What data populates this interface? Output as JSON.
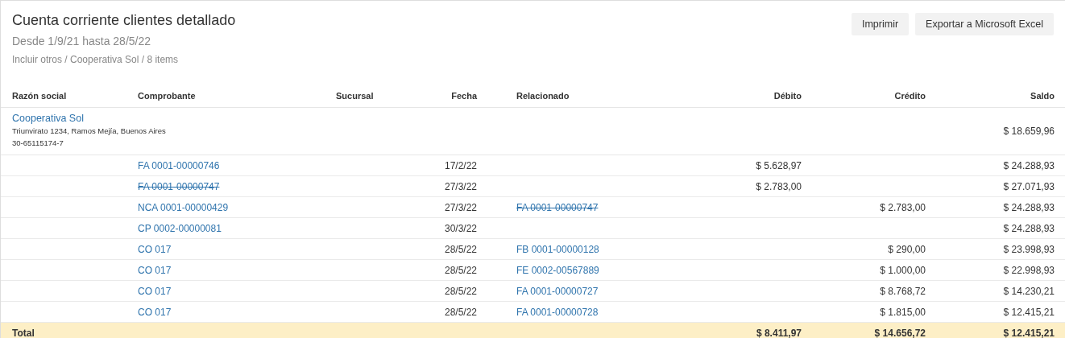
{
  "report": {
    "title": "Cuenta corriente clientes detallado",
    "period": "Desde 1/9/21 hasta 28/5/22",
    "filters": "Incluir otros / Cooperativa Sol / 8 items"
  },
  "buttons": [
    {
      "label": "Imprimir"
    },
    {
      "label": "Exportar a Microsoft Excel"
    }
  ],
  "table": {
    "columns": [
      {
        "label": "Razón social"
      },
      {
        "label": "Comprobante"
      },
      {
        "label": "Sucursal"
      },
      {
        "label": "Fecha"
      },
      {
        "label": "Relacionado"
      },
      {
        "label": "Débito"
      },
      {
        "label": "Crédito"
      },
      {
        "label": "Saldo"
      }
    ],
    "client": {
      "name": "Cooperativa Sol",
      "address": "Triunvirato 1234, Ramos Mejía, Buenos Aires",
      "tax_id": "30-65115174-7",
      "balance": "$ 18.659,96"
    },
    "rows": [
      {
        "document": {
          "text": "FA 0001-00000746",
          "annulled": false
        },
        "date": "17/2/22",
        "debit": "$ 5.628,97",
        "balance": "$ 24.288,93"
      },
      {
        "document": {
          "text": "FA 0001-00000747",
          "annulled": true
        },
        "date": "27/3/22",
        "debit": "$ 2.783,00",
        "balance": "$ 27.071,93"
      },
      {
        "document": {
          "text": "NCA 0001-00000429",
          "annulled": false
        },
        "date": "27/3/22",
        "related": {
          "text": "FA 0001-00000747",
          "annulled": true
        },
        "credit": "$ 2.783,00",
        "balance": "$ 24.288,93"
      },
      {
        "document": {
          "text": "CP 0002-00000081",
          "annulled": false
        },
        "date": "30/3/22",
        "balance": "$ 24.288,93"
      },
      {
        "document": {
          "text": "CO 017",
          "annulled": false
        },
        "date": "28/5/22",
        "related": {
          "text": "FB 0001-00000128",
          "annulled": false
        },
        "credit": "$ 290,00",
        "balance": "$ 23.998,93"
      },
      {
        "document": {
          "text": "CO 017",
          "annulled": false
        },
        "date": "28/5/22",
        "related": {
          "text": "FE 0002-00567889",
          "annulled": false
        },
        "credit": "$ 1.000,00",
        "balance": "$ 22.998,93"
      },
      {
        "document": {
          "text": "CO 017",
          "annulled": false
        },
        "date": "28/5/22",
        "related": {
          "text": "FA 0001-00000727",
          "annulled": false
        },
        "credit": "$ 8.768,72",
        "balance": "$ 14.230,21"
      },
      {
        "document": {
          "text": "CO 017",
          "annulled": false
        },
        "date": "28/5/22",
        "related": {
          "text": "FA 0001-00000728",
          "annulled": false
        },
        "credit": "$ 1.815,00",
        "balance": "$ 12.415,21"
      }
    ],
    "total": {
      "label": "Total",
      "debit": "$ 8.411,97",
      "credit": "$ 14.656,72",
      "balance": "$ 12.415,21"
    }
  }
}
